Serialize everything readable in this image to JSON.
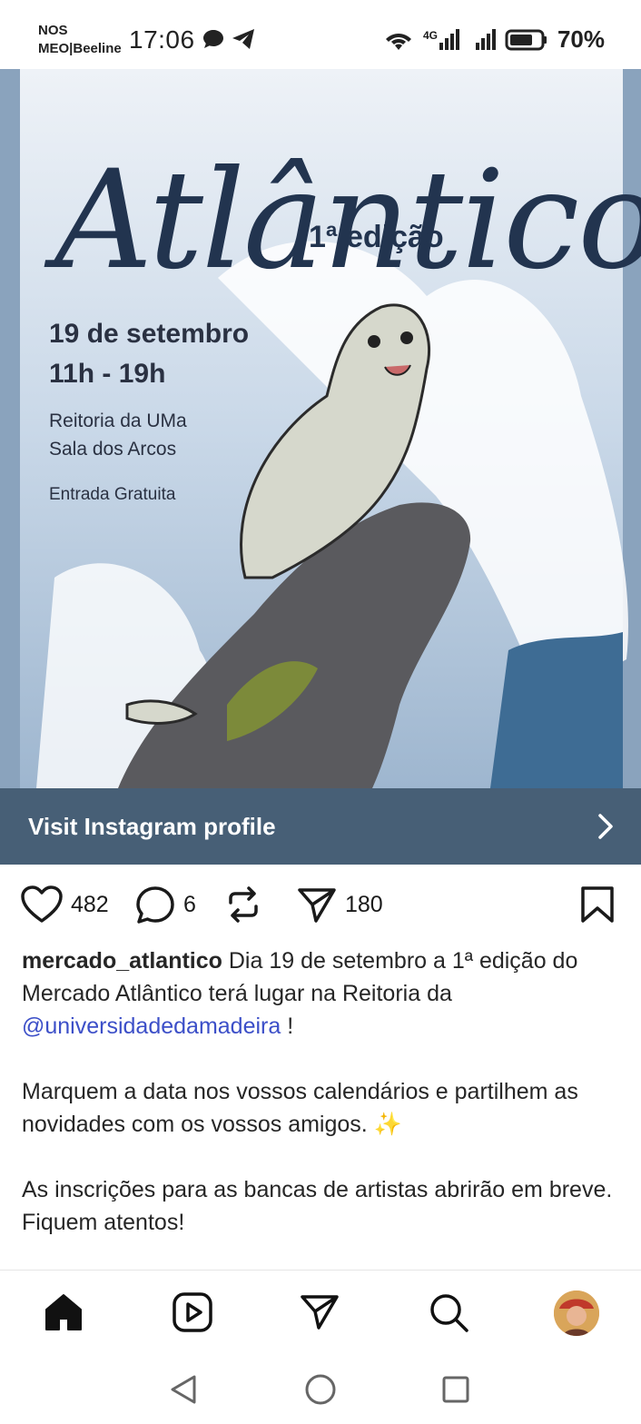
{
  "status_bar": {
    "carrier_line1": "NOS",
    "carrier_line2": "MEO|Beeline",
    "time": "17:06",
    "network": "4G",
    "battery": "70%"
  },
  "poster": {
    "title": "Atlântico",
    "edition": "1ª edição",
    "date": "19 de setembro",
    "hours": "11h - 19h",
    "place_line1": "Reitoria da UMa",
    "place_line2": "Sala dos Arcos",
    "entry": "Entrada Gratuita"
  },
  "visit_profile": {
    "label": "Visit Instagram profile",
    "icon": "chevron-right-icon"
  },
  "actions": {
    "likes": "482",
    "comments": "6",
    "shares": "180"
  },
  "caption": {
    "username": "mercado_atlantico",
    "text1": " Dia 19 de setembro a 1ª edição do Mercado Atlântico terá lugar na Reitoria da ",
    "mention": "@universidadedamadeira",
    "text1_end": " !",
    "paragraph2": "Marquem a data nos vossos calendários e partilhem as novidades com os vossos amigos. ✨",
    "paragraph3": "As inscrições para as bancas de artistas abrirão em breve. Fiquem atentos!"
  },
  "bottom_nav": {
    "items": [
      "home-icon",
      "reels-icon",
      "direct-icon",
      "search-icon",
      "profile-avatar"
    ]
  },
  "colors": {
    "visit_bar": "#475f76",
    "mention": "#3c4fc8",
    "poster_ink": "#22344f"
  }
}
